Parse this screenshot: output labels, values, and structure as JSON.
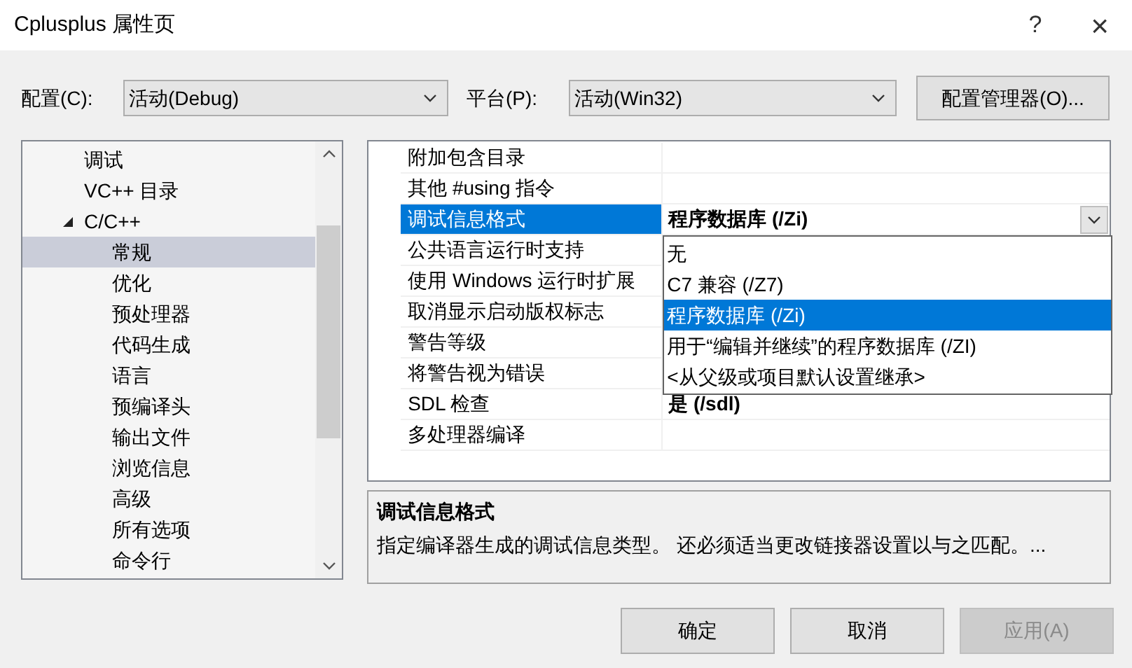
{
  "window": {
    "title": "Cplusplus 属性页",
    "help": "?",
    "close": "×"
  },
  "toolbar": {
    "config_label": "配置(C):",
    "config_value": "活动(Debug)",
    "platform_label": "平台(P):",
    "platform_value": "活动(Win32)",
    "manager_button": "配置管理器(O)..."
  },
  "tree": [
    {
      "label": "调试",
      "selected": false
    },
    {
      "label": "VC++ 目录",
      "selected": false
    },
    {
      "label": "C/C++",
      "selected": false,
      "expanded": true,
      "children": [
        {
          "label": "常规",
          "selected": true
        },
        {
          "label": "优化",
          "selected": false
        },
        {
          "label": "预处理器",
          "selected": false
        },
        {
          "label": "代码生成",
          "selected": false
        },
        {
          "label": "语言",
          "selected": false
        },
        {
          "label": "预编译头",
          "selected": false
        },
        {
          "label": "输出文件",
          "selected": false
        },
        {
          "label": "浏览信息",
          "selected": false
        },
        {
          "label": "高级",
          "selected": false
        },
        {
          "label": "所有选项",
          "selected": false
        },
        {
          "label": "命令行",
          "selected": false
        }
      ]
    }
  ],
  "properties": [
    {
      "name": "附加包含目录",
      "selected": false
    },
    {
      "name": "其他 #using 指令",
      "selected": false
    },
    {
      "name": "调试信息格式",
      "value": "程序数据库 (/Zi)",
      "selected": true
    },
    {
      "name": "公共语言运行时支持",
      "selected": false
    },
    {
      "name": "使用 Windows 运行时扩展",
      "selected": false
    },
    {
      "name": "取消显示启动版权标志",
      "selected": false
    },
    {
      "name": "警告等级",
      "selected": false
    },
    {
      "name": "将警告视为错误",
      "selected": false
    },
    {
      "name": "SDL 检查",
      "value": "是 (/sdl)",
      "selected": false
    },
    {
      "name": "多处理器编译",
      "selected": false
    }
  ],
  "dropdown_options": [
    {
      "label": "无",
      "selected": false
    },
    {
      "label": "C7 兼容 (/Z7)",
      "selected": false
    },
    {
      "label": "程序数据库 (/Zi)",
      "selected": true
    },
    {
      "label": "用于“编辑并继续”的程序数据库 (/ZI)",
      "selected": false
    },
    {
      "label": "<从父级或项目默认设置继承>",
      "selected": false
    }
  ],
  "description": {
    "title": "调试信息格式",
    "text": "指定编译器生成的调试信息类型。 还必须适当更改链接器设置以与之匹配。..."
  },
  "buttons": [
    {
      "label": "确定",
      "disabled": false
    },
    {
      "label": "取消",
      "disabled": false
    },
    {
      "label": "应用(A)",
      "disabled": true
    }
  ]
}
